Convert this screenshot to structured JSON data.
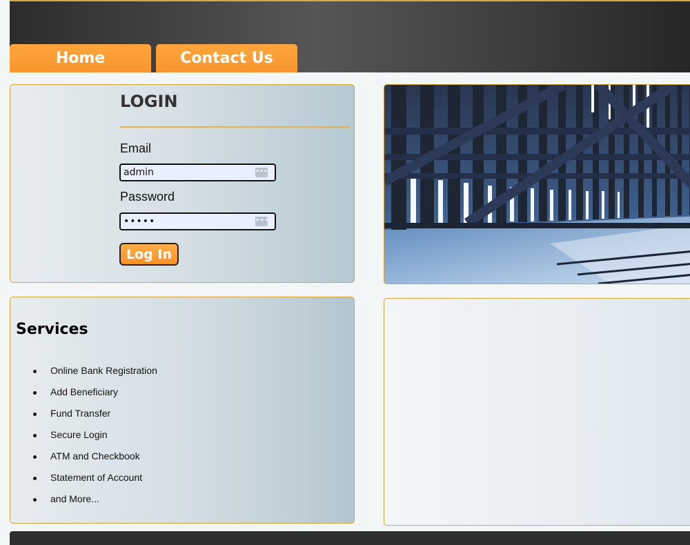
{
  "nav": {
    "home": "Home",
    "contact": "Contact Us"
  },
  "login": {
    "title": "LOGIN",
    "email_label": "Email",
    "email_value": "admin",
    "password_label": "Password",
    "password_value": "•••••",
    "button": "Log In"
  },
  "services": {
    "title": "Services",
    "items": [
      "Online Bank Registration",
      "Add Beneficiary",
      "Fund Transfer",
      "Secure Login",
      "ATM and Checkbook",
      "Statement of Account",
      "and More..."
    ]
  },
  "icons": {
    "input_icon": "password-manager-icon",
    "banner": "building-facade-image"
  },
  "colors": {
    "accent": "#f7962d",
    "border": "#d4a536",
    "header": "#3d3d3d"
  }
}
